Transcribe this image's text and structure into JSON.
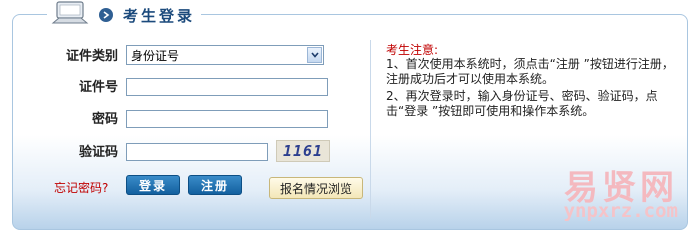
{
  "header": {
    "title": "考生登录"
  },
  "form": {
    "id_type_label": "证件类别",
    "id_type_value": "身份证号",
    "id_number_label": "证件号",
    "id_number_value": "",
    "password_label": "密码",
    "password_value": "",
    "captcha_label": "验证码",
    "captcha_value": "",
    "captcha_code": "1161",
    "forgot_link": "忘记密码?",
    "login_button": "登录",
    "register_button": "注册",
    "browse_button": "报名情况浏览"
  },
  "notice": {
    "title": "考生注意:",
    "line1": "1、首次使用本系统时，须点击“注册 ”按钮进行注册，注册成功后才可以使用本系统。",
    "line2": "2、再次登录时，输入身份证号、密码、验证码，点击“登录 ”按钮即可使用和操作本系统。"
  },
  "watermark": {
    "big": "易贤网",
    "small": "ynpxrz.com"
  },
  "colors": {
    "title": "#1b4a7c",
    "border": "#a9c6e0",
    "button": "#1a6aa8",
    "notice_title": "#c00000"
  },
  "icons": {
    "header": "monitor-icon",
    "title_marker": "arrow-right-icon",
    "select": "chevron-down-icon"
  }
}
